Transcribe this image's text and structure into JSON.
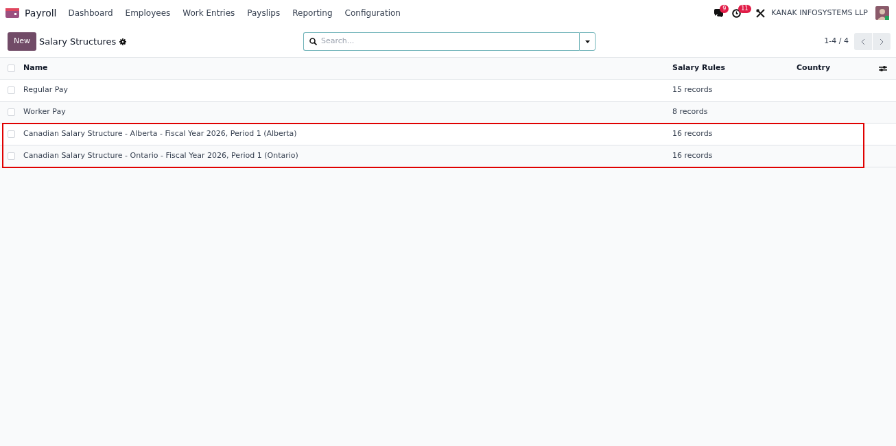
{
  "app": {
    "name": "Payroll"
  },
  "menu": [
    "Dashboard",
    "Employees",
    "Work Entries",
    "Payslips",
    "Reporting",
    "Configuration"
  ],
  "systray": {
    "messages_badge": "9",
    "activities_badge": "11",
    "company": "KANAK INFOSYSTEMS LLP"
  },
  "control_panel": {
    "new_button": "New",
    "title": "Salary Structures",
    "search": {
      "placeholder": "Search..."
    },
    "pager": "1-4 / 4"
  },
  "table": {
    "select_all_checked": false,
    "columns": [
      "Name",
      "Salary Rules",
      "Country"
    ],
    "rows": [
      {
        "name": "Regular Pay",
        "salary_rules": "15 records",
        "checked": false,
        "highlighted": false
      },
      {
        "name": "Worker Pay",
        "salary_rules": "8 records",
        "checked": false,
        "highlighted": false
      },
      {
        "name": "Canadian Salary Structure - Alberta - Fiscal Year 2026, Period 1 (Alberta)",
        "salary_rules": "16 records",
        "checked": false,
        "highlighted": true
      },
      {
        "name": "Canadian Salary Structure - Ontario - Fiscal Year 2026, Period 1 (Ontario)",
        "salary_rules": "16 records",
        "checked": false,
        "highlighted": true
      }
    ]
  }
}
